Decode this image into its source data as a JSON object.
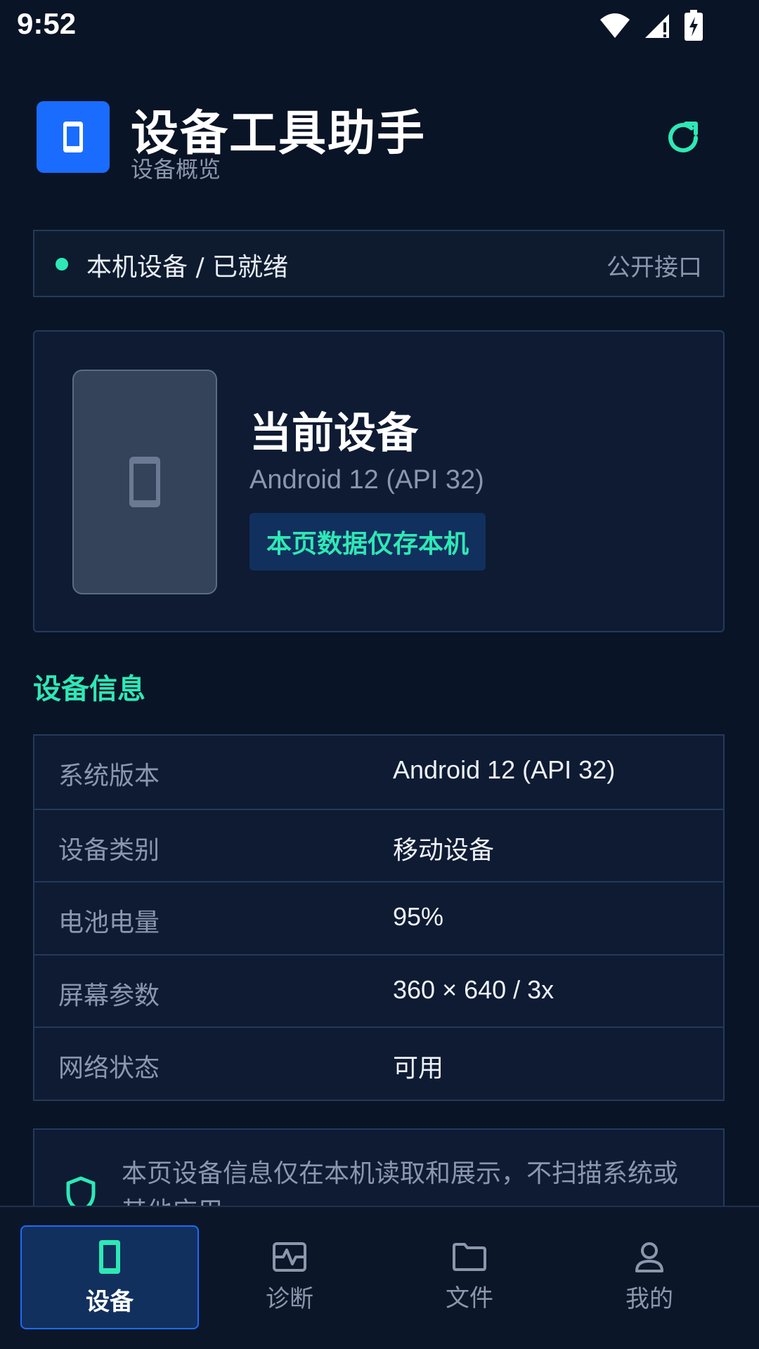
{
  "status_bar": {
    "time": "9:52"
  },
  "header": {
    "title": "设备工具助手",
    "subtitle": "设备概览",
    "accent": "#1a6cff",
    "highlight": "#2ee8b5"
  },
  "status_banner": {
    "text": "本机设备 / 已就绪",
    "link": "公开接口"
  },
  "device_card": {
    "title": "当前设备",
    "os": "Android 12 (API 32)",
    "badge": "本页数据仅存本机"
  },
  "info_section": {
    "title": "设备信息",
    "rows": [
      {
        "label": "系统版本",
        "value": "Android 12 (API 32)"
      },
      {
        "label": "设备类别",
        "value": "移动设备"
      },
      {
        "label": "电池电量",
        "value": "95%"
      },
      {
        "label": "屏幕参数",
        "value": "360 × 640 / 3x"
      },
      {
        "label": "网络状态",
        "value": "可用"
      }
    ]
  },
  "privacy": {
    "text": "本页设备信息仅在本机读取和展示，不扫描系统或其他应用"
  },
  "bottom_nav": {
    "items": [
      {
        "label": "设备",
        "icon": "phone-icon",
        "active": true
      },
      {
        "label": "诊断",
        "icon": "pulse-icon",
        "active": false
      },
      {
        "label": "文件",
        "icon": "folder-icon",
        "active": false
      },
      {
        "label": "我的",
        "icon": "person-icon",
        "active": false
      }
    ]
  }
}
